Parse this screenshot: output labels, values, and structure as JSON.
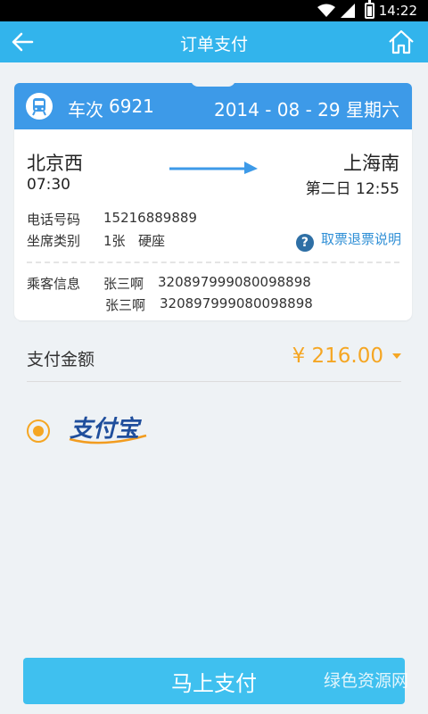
{
  "status_bar": {
    "time": "14:22"
  },
  "header": {
    "title": "订单支付"
  },
  "ticket": {
    "train_label": "车次",
    "train_number": "6921",
    "date": "2014 - 08 - 29 星期六",
    "from_station": "北京西",
    "depart_time": "07:30",
    "to_station": "上海南",
    "arrive_time": "第二日 12:55",
    "phone_label": "电话号码",
    "phone": "15216889889",
    "seat_label": "坐席类别",
    "seat_count": "1张",
    "seat_type": "硬座",
    "refund_link": "取票退票说明",
    "passenger_label": "乘客信息",
    "passengers": [
      {
        "name": "张三啊",
        "id": "320897999080098898"
      },
      {
        "name": "张三啊",
        "id": "320897999080098898"
      }
    ]
  },
  "payment": {
    "label": "支付金额",
    "amount": "¥ 216.00",
    "method": "支付宝",
    "method_selected": true
  },
  "pay_button": "马上支付",
  "watermark": "绿色资源网",
  "colors": {
    "header": "#32b4ec",
    "card_head": "#3d9ae8",
    "amount": "#f5a623",
    "button": "#3fc0ef",
    "link": "#2f8fd6"
  },
  "icons": [
    "wifi-icon",
    "signal-icon",
    "battery-icon",
    "back-arrow-icon",
    "home-icon",
    "train-icon",
    "direction-arrow-icon",
    "question-icon",
    "dropdown-triangle-icon",
    "alipay-logo"
  ]
}
